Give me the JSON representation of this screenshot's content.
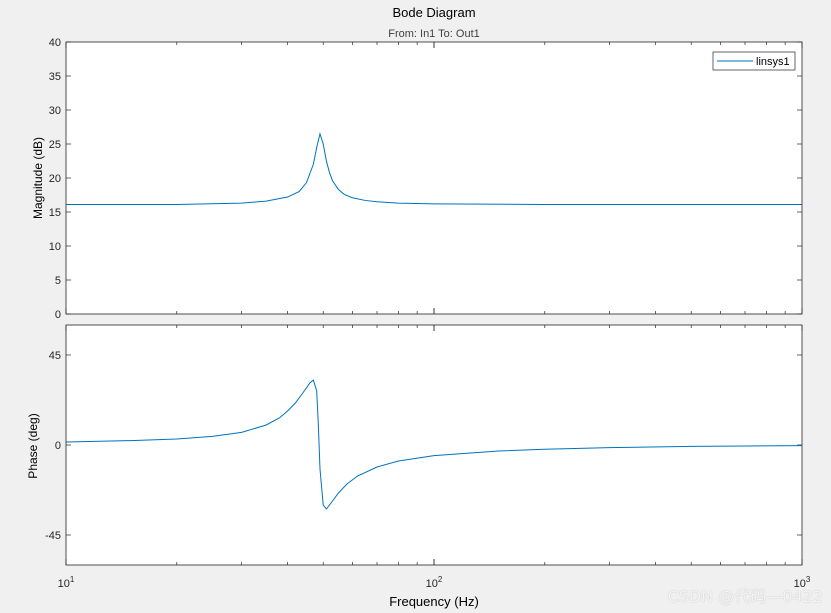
{
  "chart_data": {
    "type": "line",
    "title": "Bode Diagram",
    "subtitle": "From: In1  To: Out1",
    "xlabel": "Frequency  (Hz)",
    "xscale": "log",
    "xlim": [
      10,
      1000
    ],
    "xticks": [
      {
        "value": 10,
        "base": "10",
        "exp": "1"
      },
      {
        "value": 100,
        "base": "10",
        "exp": "2"
      },
      {
        "value": 1000,
        "base": "10",
        "exp": "3"
      }
    ],
    "legend": {
      "entries": [
        "linsys1"
      ],
      "placement": "top-right"
    },
    "line_color": "#0072bd",
    "magnitude": {
      "ylabel": "Magnitude (dB)",
      "ylim": [
        0,
        40
      ],
      "yticks": [
        0,
        5,
        10,
        15,
        20,
        25,
        30,
        35,
        40
      ],
      "series": {
        "name": "linsys1",
        "x": [
          10,
          20,
          30,
          35,
          40,
          43,
          45,
          47,
          48,
          49,
          50,
          51,
          52,
          53,
          55,
          57,
          60,
          65,
          70,
          80,
          100,
          200,
          500,
          1000
        ],
        "y": [
          16.1,
          16.1,
          16.3,
          16.6,
          17.2,
          18.0,
          19.3,
          22.0,
          24.5,
          26.5,
          25.0,
          22.5,
          20.8,
          19.6,
          18.3,
          17.6,
          17.1,
          16.7,
          16.5,
          16.3,
          16.2,
          16.1,
          16.1,
          16.1
        ]
      }
    },
    "phase": {
      "ylabel": "Phase (deg)",
      "ylim": [
        -60,
        60
      ],
      "yticks": [
        -45,
        0,
        45
      ],
      "series": {
        "name": "linsys1",
        "x": [
          10,
          15,
          20,
          25,
          30,
          35,
          38,
          40,
          42,
          44,
          46,
          47,
          48,
          48.5,
          49,
          50,
          51,
          52,
          53,
          55,
          58,
          62,
          70,
          80,
          100,
          150,
          200,
          300,
          500,
          1000
        ],
        "y": [
          1.5,
          2.2,
          3.0,
          4.3,
          6.3,
          10.0,
          13.5,
          17.0,
          21.0,
          26.0,
          31.0,
          32.5,
          27.0,
          10.0,
          -12.0,
          -30.0,
          -32.0,
          -30.0,
          -28.0,
          -24.0,
          -19.5,
          -15.5,
          -11.0,
          -8.0,
          -5.3,
          -3.0,
          -2.1,
          -1.3,
          -0.7,
          -0.3
        ]
      }
    }
  },
  "watermark": "CSDN @代码—0422"
}
